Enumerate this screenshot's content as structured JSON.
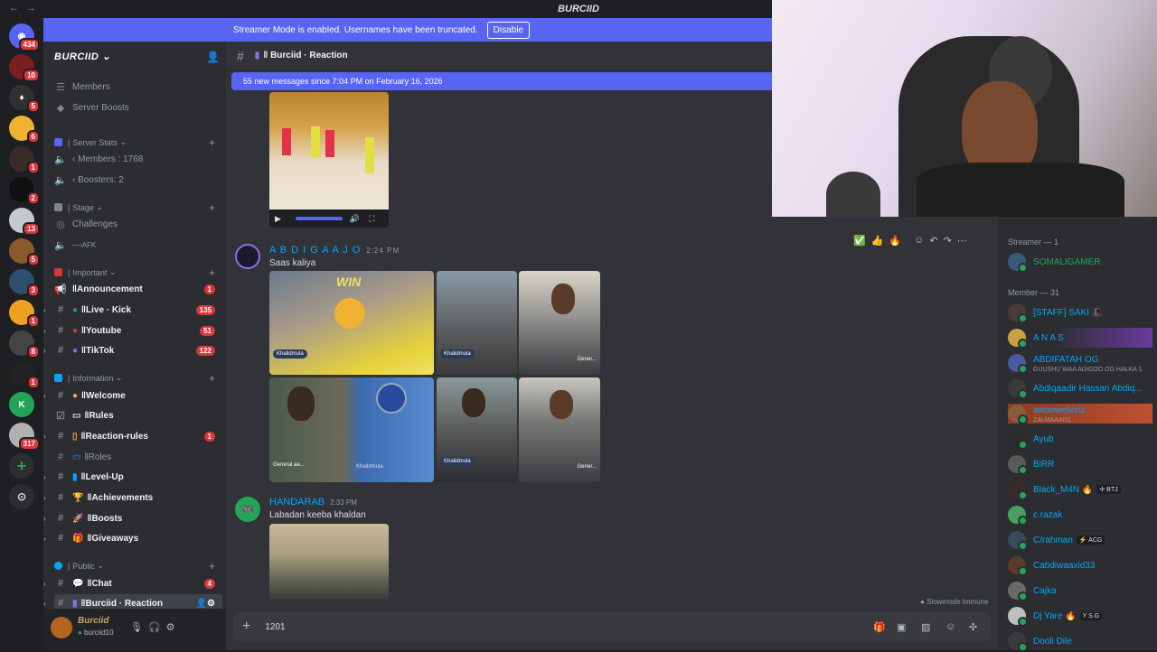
{
  "window": {
    "title": "BURCIID",
    "back": "←",
    "forward": "→"
  },
  "streamer_banner": {
    "text": "Streamer Mode is enabled. Usernames have been truncated.",
    "button": "Disable"
  },
  "guilds": [
    {
      "badge": "434",
      "color": "#5865f2",
      "glyph": "◉"
    },
    {
      "badge": "10",
      "color": "#7a1f1f",
      "glyph": ""
    },
    {
      "badge": "5",
      "color": "#303030",
      "glyph": "♦"
    },
    {
      "badge": "6",
      "color": "#f0b232",
      "glyph": ""
    },
    {
      "badge": "1",
      "color": "#3a2a2a",
      "glyph": ""
    },
    {
      "badge": "2",
      "color": "#111111",
      "glyph": ""
    },
    {
      "badge": "13",
      "color": "#c4c9ce",
      "glyph": ""
    },
    {
      "badge": "5",
      "color": "#8b5a2b",
      "glyph": ""
    },
    {
      "badge": "3",
      "color": "#2f4f6f",
      "glyph": ""
    },
    {
      "badge": "1",
      "color": "#f0a020",
      "glyph": ""
    },
    {
      "badge": "8",
      "color": "#444444",
      "glyph": ""
    },
    {
      "badge": "1",
      "color": "#222222",
      "glyph": ""
    },
    {
      "badge": "",
      "color": "#23a559",
      "glyph": "K"
    },
    {
      "badge": "317",
      "color": "#b0b0b0",
      "glyph": ""
    }
  ],
  "server": {
    "name": "BURCIID"
  },
  "sidebar": {
    "top_items": [
      {
        "label": "Members",
        "icon": "members-icon"
      },
      {
        "label": "Server Boosts",
        "icon": "boost-icon"
      }
    ],
    "categories": [
      {
        "label": "Server Stats"
      },
      {
        "label": "Stage"
      },
      {
        "label": "Important"
      },
      {
        "label": "Information"
      },
      {
        "label": "Public"
      }
    ],
    "stats": [
      "‹ Members : 1768",
      "‹ Boosters: 2"
    ],
    "stage": [
      "Challenges",
      "—›AFK"
    ],
    "important": [
      {
        "label": "Announcement",
        "badge": "1"
      },
      {
        "label": "Live · Kick",
        "badge": "135"
      },
      {
        "label": "Youtube",
        "badge": "51"
      },
      {
        "label": "TikTok",
        "badge": "122"
      }
    ],
    "information": [
      {
        "label": "Welcome",
        "badge": ""
      },
      {
        "label": "Rules",
        "badge": ""
      },
      {
        "label": "Reaction-rules",
        "badge": "1"
      },
      {
        "label": "Roles",
        "badge": ""
      },
      {
        "label": "Level-Up",
        "badge": ""
      },
      {
        "label": "Achievements",
        "badge": ""
      },
      {
        "label": "Boosts",
        "badge": ""
      },
      {
        "label": "Giveaways",
        "badge": ""
      }
    ],
    "public": [
      {
        "label": "Chat",
        "badge": "4"
      },
      {
        "label": "Burciid · Reaction",
        "badge": ""
      }
    ]
  },
  "user": {
    "name": "Burciid",
    "tag": "burciid10"
  },
  "chat": {
    "channel_name": "Burciid · Reaction",
    "new_messages": "55 new messages since 7:04 PM on February 16, 2026",
    "messages": [
      {
        "author": "A B D I G A A J O",
        "time": "2:24 PM",
        "text": "Saas kaliya"
      },
      {
        "author": "HANDARAB",
        "time": "2:33 PM",
        "text": "Labadan keeba khaldan"
      }
    ],
    "image_captions": [
      "WIN",
      "Khalidmula",
      "Khalidmula",
      "Gener...",
      "General aa...",
      "Khalidmula",
      "Khalidmula",
      "Gener..."
    ],
    "reactions": [
      "✅",
      "👍",
      "🔥"
    ],
    "slowmode": "Slowmode Immune",
    "composer_value": "1201"
  },
  "members": {
    "groups": [
      {
        "label": "Streamer — 1"
      },
      {
        "label": "Member — 31"
      }
    ],
    "streamers": [
      {
        "name": "SOMALIGAMER",
        "color": "#23a559",
        "sub": "",
        "tag": ""
      }
    ],
    "list": [
      {
        "name": "[STAFF] SAKI 🎩",
        "sub": "",
        "tag": "",
        "color": "#00a8fc"
      },
      {
        "name": "A N A S",
        "sub": "",
        "tag": "",
        "color": "#00a8fc"
      },
      {
        "name": "ABDIFATAH OG",
        "sub": "GUUSHU WAA ADIGOO OG HALKA 1",
        "tag": "",
        "color": "#00a8fc"
      },
      {
        "name": "Abdiqaadir Hassan Abdiq...",
        "sub": "",
        "tag": "",
        "color": "#00a8fc"
      },
      {
        "name": "awoowekoriz",
        "sub": "ZALMAAAN1",
        "tag": "",
        "color": "#00a8fc"
      },
      {
        "name": "Ayub",
        "sub": "",
        "tag": "",
        "color": "#00a8fc"
      },
      {
        "name": "BiRR",
        "sub": "",
        "tag": "",
        "color": "#00a8fc"
      },
      {
        "name": "Black_M4N 🔥",
        "sub": "",
        "tag": "✢ BTJ",
        "color": "#00a8fc"
      },
      {
        "name": "c.razak",
        "sub": "",
        "tag": "",
        "color": "#00a8fc"
      },
      {
        "name": "C/rahman",
        "sub": "",
        "tag": "⚡ ACG",
        "color": "#00a8fc"
      },
      {
        "name": "Cabdiwaaxid33",
        "sub": "",
        "tag": "",
        "color": "#00a8fc"
      },
      {
        "name": "Cajka",
        "sub": "",
        "tag": "",
        "color": "#00a8fc"
      },
      {
        "name": "Dj Yare 🔥",
        "sub": "",
        "tag": "Y S.G",
        "color": "#00a8fc"
      },
      {
        "name": "Dooli Dile",
        "sub": "",
        "tag": "",
        "color": "#00a8fc"
      }
    ]
  }
}
